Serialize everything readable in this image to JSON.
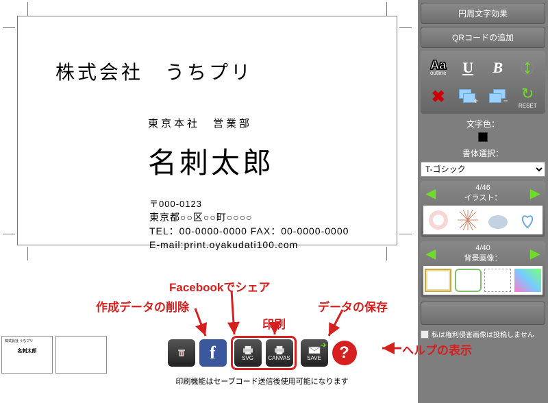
{
  "card": {
    "company": "株式会社　うちプリ",
    "dept": "東京本社　営業部",
    "name": "名刺太郎",
    "zip": "〒000-0123",
    "address": "東京都○○区○○町○○○○",
    "tel": "TEL：00-0000-0000 FAX：00-0000-0000",
    "mail": "E-mail:print.oyakudati100.com"
  },
  "right": {
    "circular_text": "円周文字効果",
    "qr_add": "QRコードの追加",
    "outline_lbl": "outline",
    "reset_lbl": "RESET",
    "text_color_lbl": "文字色：",
    "font_lbl": "書体選択：",
    "font_value": "T-ゴシック",
    "illust_count": "4/46",
    "illust_lbl": "イラスト：",
    "bg_count": "4/40",
    "bg_lbl": "背景画像：",
    "rights_chk": "私は権利侵害画像は投稿しません"
  },
  "toolbar": {
    "svg_lbl": "SVG",
    "canvas_lbl": "CANVAS",
    "save_lbl": "SAVE",
    "note": "印刷機能はセーブコード送信後使用可能になります"
  },
  "callouts": {
    "delete": "作成データの削除",
    "fb": "Facebookでシェア",
    "print": "印刷",
    "save": "データの保存",
    "help": "ヘルプの表示"
  }
}
